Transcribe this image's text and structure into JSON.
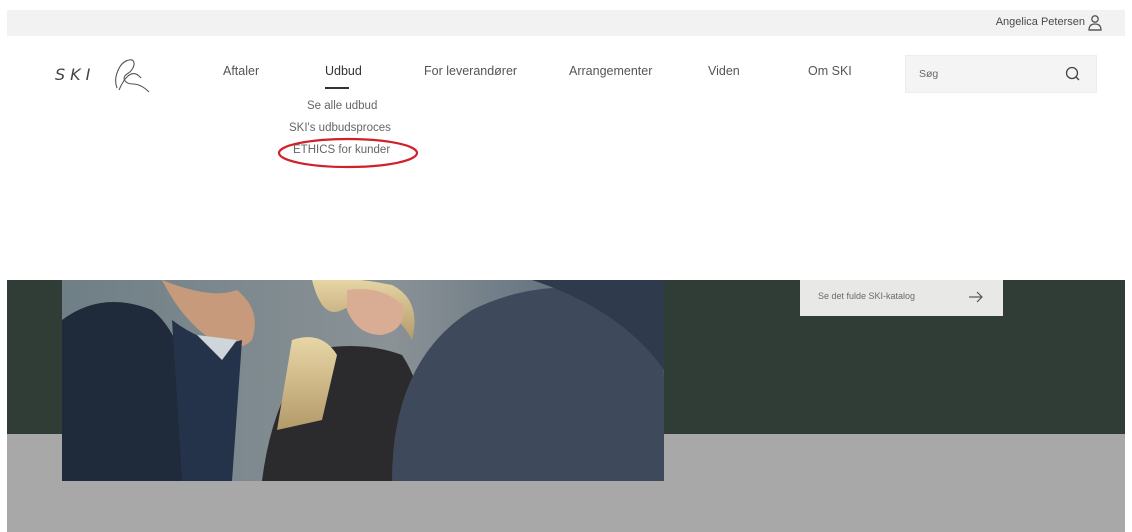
{
  "topbar": {
    "user_name": "Angelica Petersen",
    "user_icon": "user-icon"
  },
  "header": {
    "logo_text": "SKI",
    "nav": [
      {
        "label": "Aftaler"
      },
      {
        "label": "Udbud",
        "active": true
      },
      {
        "label": "For leverandører"
      },
      {
        "label": "Arrangementer"
      },
      {
        "label": "Viden"
      },
      {
        "label": "Om SKI"
      }
    ],
    "dropdown": [
      {
        "label": "Se alle udbud"
      },
      {
        "label": "SKI's udbudsproces"
      },
      {
        "label": "ETHICS for kunder",
        "highlighted": true
      }
    ],
    "search": {
      "placeholder": "Søg",
      "icon": "search-icon"
    }
  },
  "hero": {
    "catalog_button_label": "Se det fulde SKI-katalog",
    "arrow_icon": "arrow-right-icon"
  },
  "colors": {
    "hero_dark": "#303c36",
    "hero_gray": "#a8a8a8",
    "highlight": "#d0202a",
    "topbar_bg": "#f1f2f1"
  }
}
